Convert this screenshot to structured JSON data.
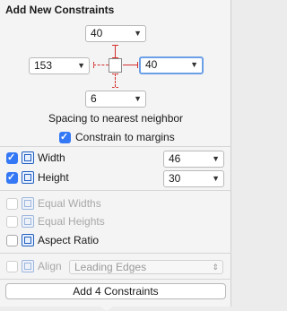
{
  "title": "Add New Constraints",
  "spacing": {
    "top": "40",
    "left": "153",
    "right": "40",
    "bottom": "6",
    "label": "Spacing to nearest neighbor"
  },
  "constrain_margins": {
    "label": "Constrain to margins",
    "checked": true
  },
  "size": {
    "width": {
      "label": "Width",
      "value": "46",
      "checked": true
    },
    "height": {
      "label": "Height",
      "value": "30",
      "checked": true
    }
  },
  "equal": {
    "widths": {
      "label": "Equal Widths",
      "checked": false,
      "enabled": false
    },
    "heights": {
      "label": "Equal Heights",
      "checked": false,
      "enabled": false
    }
  },
  "aspect_ratio": {
    "label": "Aspect Ratio",
    "checked": false
  },
  "align": {
    "label": "Align",
    "value": "Leading Edges",
    "enabled": false
  },
  "add_button": "Add 4 Constraints",
  "colors": {
    "accent": "#3478f6",
    "constraint": "#d32f2f",
    "icon": "#1f5fbf"
  }
}
